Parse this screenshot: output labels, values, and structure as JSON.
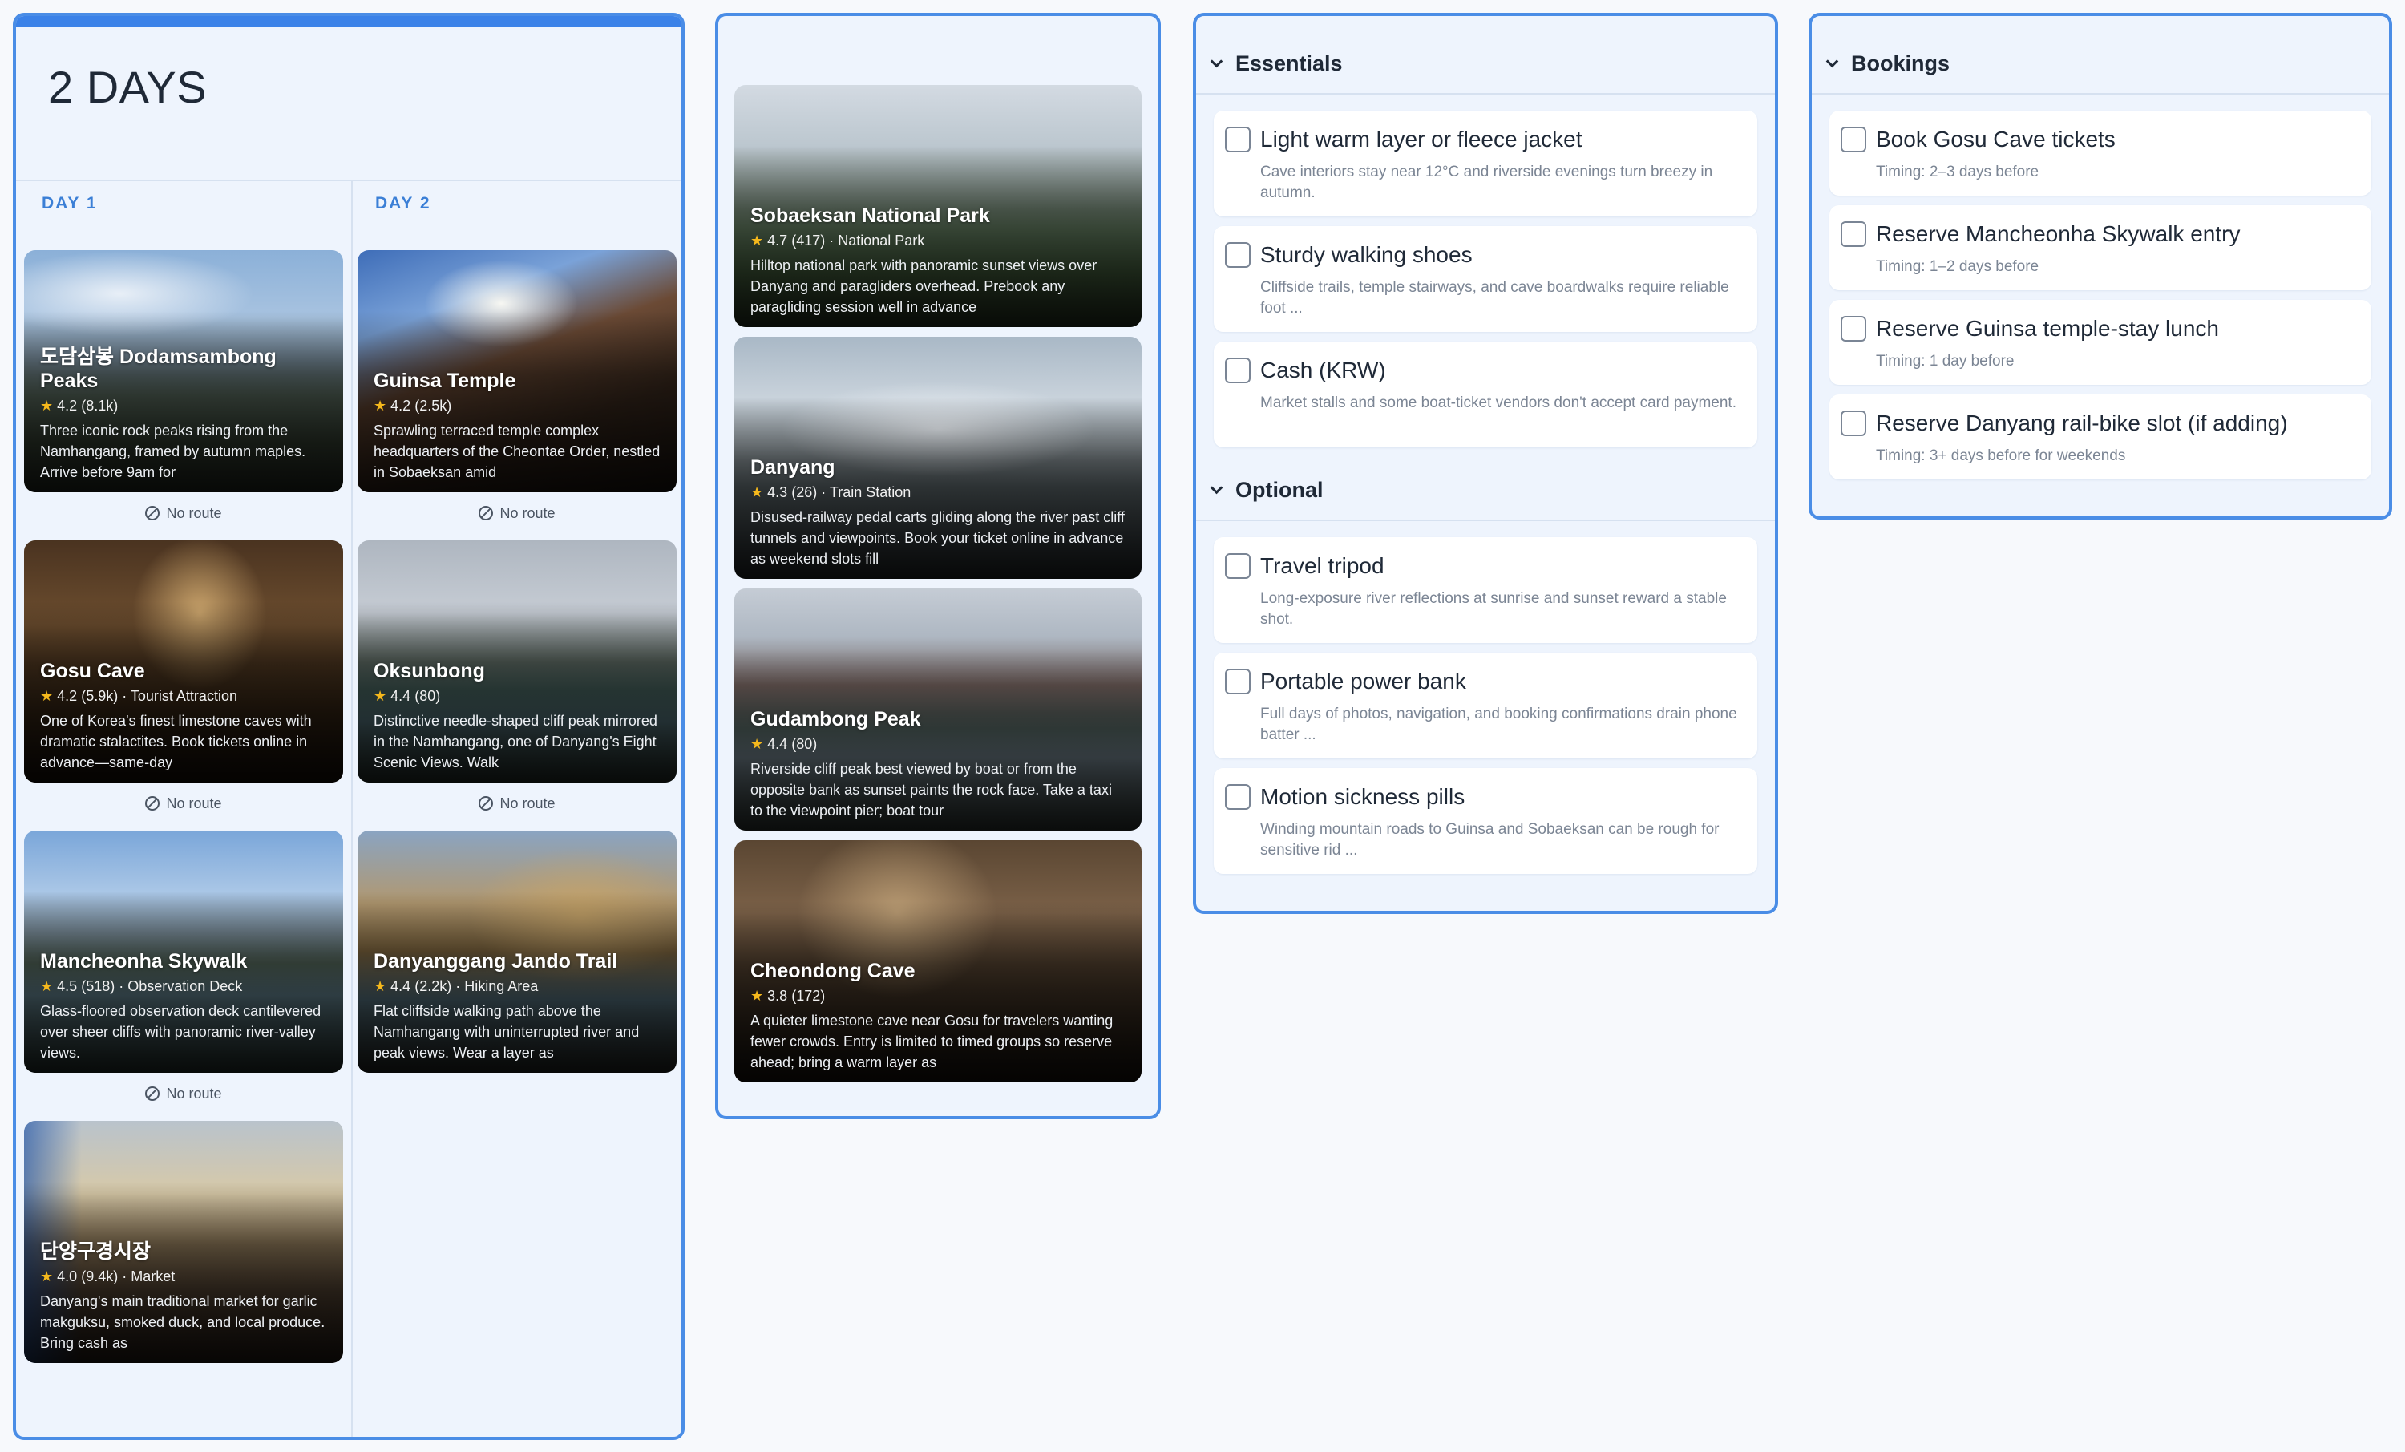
{
  "itinerary": {
    "title": "2 DAYS",
    "days": [
      {
        "label": "DAY 1",
        "stops": [
          {
            "name": "도담삼봉 Dodamsambong Peaks",
            "rating": "4.2",
            "reviews": "(8.1k)",
            "category": "",
            "desc": "Three iconic rock peaks rising from the Namhangang, framed by autumn maples. Arrive before 9am for",
            "route": "No route"
          },
          {
            "name": "Gosu Cave",
            "rating": "4.2",
            "reviews": "(5.9k)",
            "category": "· Tourist Attraction",
            "desc": "One of Korea's finest limestone caves with dramatic stalactites. Book tickets online in advance—same-day",
            "route": "No route"
          },
          {
            "name": "Mancheonha Skywalk",
            "rating": "4.5",
            "reviews": "(518)",
            "category": "· Observation Deck",
            "desc": "Glass-floored observation deck cantilevered over sheer cliffs with panoramic river-valley views.",
            "route": "No route"
          },
          {
            "name": "단양구경시장",
            "rating": "4.0",
            "reviews": "(9.4k)",
            "category": "· Market",
            "desc": "Danyang's main traditional market for garlic makguksu, smoked duck, and local produce. Bring cash as",
            "route": ""
          }
        ]
      },
      {
        "label": "DAY 2",
        "stops": [
          {
            "name": "Guinsa Temple",
            "rating": "4.2",
            "reviews": "(2.5k)",
            "category": "",
            "desc": "Sprawling terraced temple complex headquarters of the Cheontae Order, nestled in Sobaeksan amid",
            "route": "No route"
          },
          {
            "name": "Oksunbong",
            "rating": "4.4",
            "reviews": "(80)",
            "category": "",
            "desc": "Distinctive needle-shaped cliff peak mirrored in the Namhangang, one of Danyang's Eight Scenic Views. Walk",
            "route": "No route"
          },
          {
            "name": "Danyanggang Jando Trail",
            "rating": "4.4",
            "reviews": "(2.2k)",
            "category": "· Hiking Area",
            "desc": "Flat cliffside walking path above the Namhangang with uninterrupted river and peak views. Wear a layer as",
            "route": ""
          }
        ]
      }
    ]
  },
  "places": [
    {
      "name": "Sobaeksan National Park",
      "rating": "4.7",
      "reviews": "(417)",
      "category": "· National Park",
      "desc": "Hilltop national park with panoramic sunset views over Danyang and paragliders overhead. Prebook any paragliding session well in advance"
    },
    {
      "name": "Danyang",
      "rating": "4.3",
      "reviews": "(26)",
      "category": "· Train Station",
      "desc": "Disused-railway pedal carts gliding along the river past cliff tunnels and viewpoints. Book your ticket online in advance as weekend slots fill"
    },
    {
      "name": "Gudambong Peak",
      "rating": "4.4",
      "reviews": "(80)",
      "category": "",
      "desc": "Riverside cliff peak best viewed by boat or from the opposite bank as sunset paints the rock face. Take a taxi to the viewpoint pier; boat tour"
    },
    {
      "name": "Cheondong Cave",
      "rating": "3.8",
      "reviews": "(172)",
      "category": "",
      "desc": "A quieter limestone cave near Gosu for travelers wanting fewer crowds. Entry is limited to timed groups so reserve ahead; bring a warm layer as"
    }
  ],
  "packing": {
    "essentials_title": "Essentials",
    "essentials": [
      {
        "label": "Light warm layer or fleece jacket",
        "note": "Cave interiors stay near 12°C and riverside evenings turn breezy in autumn."
      },
      {
        "label": "Sturdy walking shoes",
        "note": "Cliffside trails, temple stairways, and cave boardwalks require reliable foot ..."
      },
      {
        "label": "Cash (KRW)",
        "note": "Market stalls and some boat-ticket vendors don't accept card payment."
      }
    ],
    "optional_title": "Optional",
    "optional": [
      {
        "label": "Travel tripod",
        "note": "Long-exposure river reflections at sunrise and sunset reward a stable shot."
      },
      {
        "label": "Portable power bank",
        "note": "Full days of photos, navigation, and booking confirmations drain phone batter ..."
      },
      {
        "label": "Motion sickness pills",
        "note": "Winding mountain roads to Guinsa and Sobaeksan can be rough for sensitive rid ..."
      }
    ]
  },
  "bookings": {
    "title": "Bookings",
    "items": [
      {
        "label": "Book Gosu Cave tickets",
        "timing": "Timing: 2–3 days before"
      },
      {
        "label": "Reserve Mancheonha Skywalk entry",
        "timing": "Timing: 1–2 days before"
      },
      {
        "label": "Reserve Guinsa temple-stay lunch",
        "timing": "Timing: 1 day before"
      },
      {
        "label": "Reserve Danyang rail-bike slot (if adding)",
        "timing": "Timing: 3+ days before for weekends"
      }
    ]
  },
  "icons": {
    "rating": "star-icon",
    "no_route": "ban-icon",
    "collapse": "chevron-down-icon"
  },
  "colors": {
    "accent": "#3b82e8",
    "panel_bg": "#eef4fd",
    "star": "#f5b81c",
    "day_label": "#3b7fd6"
  }
}
